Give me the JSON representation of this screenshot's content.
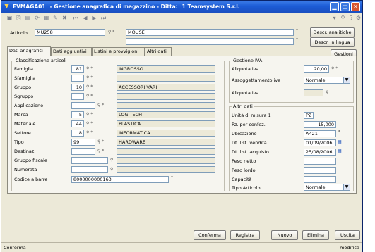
{
  "window": {
    "title_code": "EVMAGA01",
    "title_text": "- Gestione anagrafica di magazzino - Ditta:",
    "title_company": "1 Teamsystem S.r.l."
  },
  "header": {
    "article_label": "Articolo",
    "article_code": "MU258",
    "article_desc": "MOUSE",
    "article_desc2": "",
    "btn_descr_analitiche": "Descr. analitiche",
    "btn_descr_lingua": "Descr. in lingua",
    "btn_gestioni": "Gestioni"
  },
  "tabs": [
    "Dati anagrafici",
    "Dati aggiuntivi",
    "Listini e provvigioni",
    "Altri dati"
  ],
  "classificazione": {
    "title": "Classificazione articoli",
    "rows": [
      {
        "label": "Famiglia",
        "code": "81",
        "desc": "INGROSSO"
      },
      {
        "label": "Sfamiglia",
        "code": "",
        "desc": ""
      },
      {
        "label": "Gruppo",
        "code": "10",
        "desc": "ACCESSORI VARI"
      },
      {
        "label": "Sgruppo",
        "code": "",
        "desc": ""
      },
      {
        "label": "Applicazione",
        "code": "",
        "desc": ""
      },
      {
        "label": "Marca",
        "code": "5",
        "desc": "LOGITECH"
      },
      {
        "label": "Materiale",
        "code": "44",
        "desc": "PLASTICA"
      },
      {
        "label": "Settore",
        "code": "8",
        "desc": "INFORMATICA"
      },
      {
        "label": "Tipo",
        "code": "99",
        "desc": "HARDWARE"
      },
      {
        "label": "Destinaz.",
        "code": "",
        "desc": ""
      },
      {
        "label": "Gruppo fiscale",
        "code": "",
        "desc": ""
      },
      {
        "label": "Numerata",
        "code": "",
        "desc": ""
      }
    ],
    "barcode_label": "Codice a barre",
    "barcode_value": "8000000000163"
  },
  "iva": {
    "title": "Gestione IVA",
    "aliquota_label": "Aliquota iva",
    "aliquota_value": "20,00",
    "assogg_label": "Assoggettamento iva",
    "assogg_value": "Normale",
    "aliquota2_label": "Aliquota iva",
    "aliquota2_value": ""
  },
  "altri": {
    "title": "Altri dati",
    "um_label": "Unità di misura 1",
    "um_value": "PZ",
    "pz_label": "Pz. per confez.",
    "pz_value": "15,000",
    "ubic_label": "Ubicazione",
    "ubic_value": "A421",
    "dt_vendita_label": "Dt. list. vendita",
    "dt_vendita_value": "01/09/2006",
    "dt_acquisto_label": "Dt. list. acquisto",
    "dt_acquisto_value": "25/08/2006",
    "peso_netto_label": "Peso netto",
    "peso_lordo_label": "Peso lordo",
    "capacita_label": "Capacità",
    "tipo_art_label": "Tipo Articolo",
    "tipo_art_value": "Normale"
  },
  "footer": {
    "conferma": "Conferma",
    "registra": "Registra",
    "nuovo": "Nuovo",
    "elimina": "Elimina",
    "uscita": "Uscita"
  },
  "status": {
    "left": "Conferma",
    "right": "modifica"
  }
}
